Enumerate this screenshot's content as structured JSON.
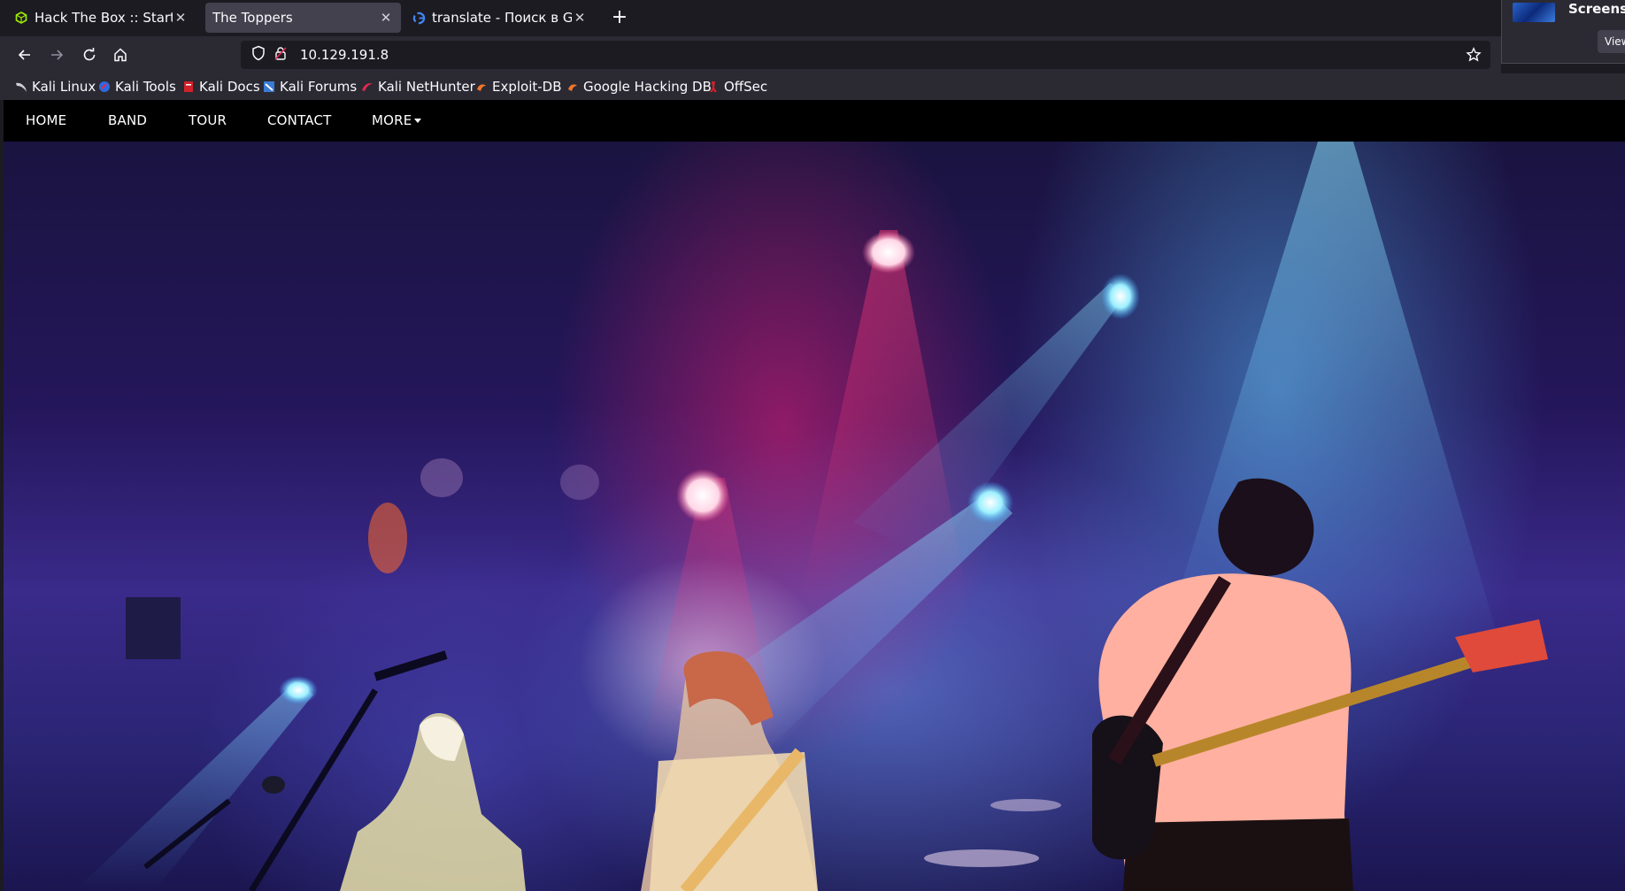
{
  "tabs": [
    {
      "title": "Hack The Box :: Starting P",
      "favicon": "htb-cube-icon",
      "active": false
    },
    {
      "title": "The Toppers",
      "favicon": "",
      "active": true
    },
    {
      "title": "translate - Поиск в Googl",
      "favicon": "google-icon",
      "active": false
    }
  ],
  "toolbar": {
    "url": "10.129.191.8"
  },
  "bookmarks": [
    {
      "label": "Kali Linux",
      "icon": "kali-dragon-icon"
    },
    {
      "label": "Kali Tools",
      "icon": "kali-tools-icon"
    },
    {
      "label": "Kali Docs",
      "icon": "kali-docs-icon"
    },
    {
      "label": "Kali Forums",
      "icon": "kali-forums-icon"
    },
    {
      "label": "Kali NetHunter",
      "icon": "nethunter-icon"
    },
    {
      "label": "Exploit-DB",
      "icon": "exploit-db-icon"
    },
    {
      "label": "Google Hacking DB",
      "icon": "ghdb-icon"
    },
    {
      "label": "OffSec",
      "icon": "offsec-icon"
    }
  ],
  "notification": {
    "title": "Screensho",
    "button": "View"
  },
  "site": {
    "nav": [
      "HOME",
      "BAND",
      "TOUR",
      "CONTACT",
      "MORE"
    ]
  },
  "colors": {
    "tabbar_bg": "#1c1b22",
    "toolbar_bg": "#2b2a33",
    "active_tab_bg": "#42414d",
    "site_nav_bg": "#000000"
  }
}
